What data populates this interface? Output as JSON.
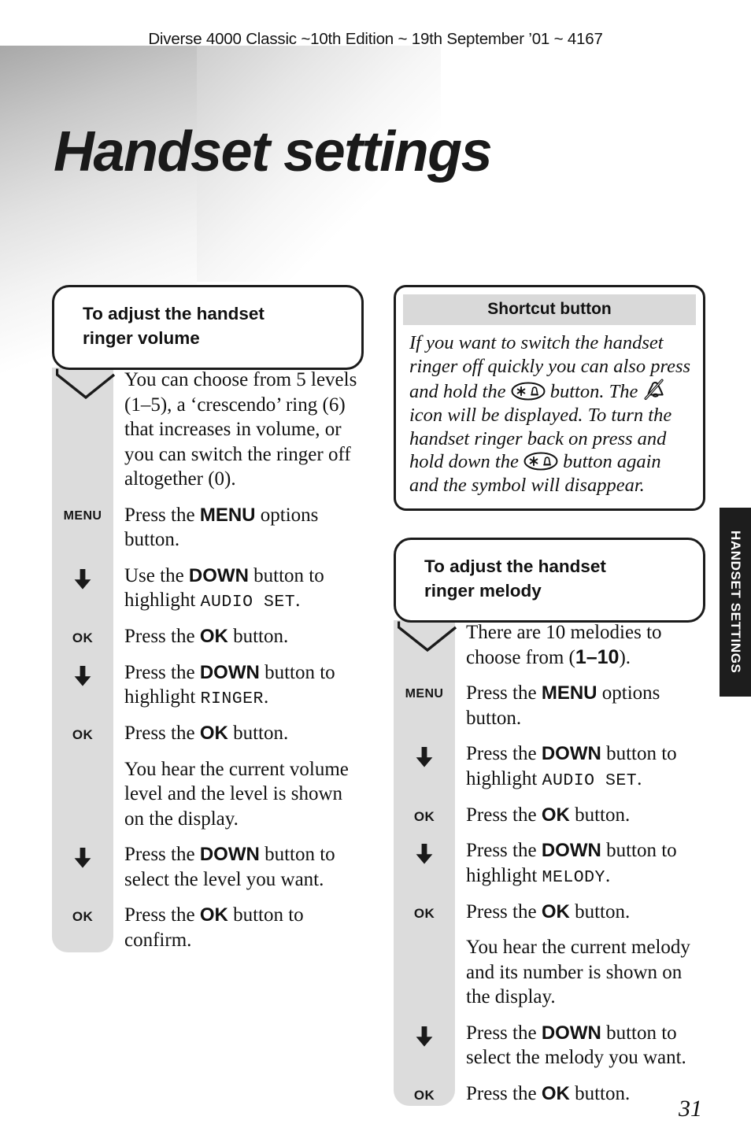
{
  "page": {
    "running_head": "Diverse 4000 Classic ~10th Edition ~ 19th September ’01 ~ 4167",
    "chapter_title": "Handset settings",
    "thumb_tab": "HANDSET SETTINGS",
    "folio": "31",
    "accent_black": "#1d1d1d",
    "rail_grey": "#dcdcdc",
    "band_grey": "#d9d9d9"
  },
  "left_column": {
    "callout": {
      "line1": "To adjust the handset",
      "line2": "ringer volume"
    },
    "steps": [
      {
        "key": "",
        "key_type": "none",
        "text_parts": [
          {
            "t": "You can choose from 5 levels (1–5), a ‘crescendo’ ring (6) that increases in volume, or you can switch the ringer off altogether (0).",
            "style": "normal"
          }
        ]
      },
      {
        "key": "MENU",
        "key_type": "label",
        "text_parts": [
          {
            "t": "Press the ",
            "style": "normal"
          },
          {
            "t": "MENU",
            "style": "bold"
          },
          {
            "t": " options button.",
            "style": "normal"
          }
        ]
      },
      {
        "key": "",
        "key_type": "arrow-down",
        "text_parts": [
          {
            "t": "Use the ",
            "style": "normal"
          },
          {
            "t": "DOWN",
            "style": "bold"
          },
          {
            "t": " button to highlight ",
            "style": "normal"
          },
          {
            "t": "AUDIO SET",
            "style": "lcd"
          },
          {
            "t": ".",
            "style": "normal"
          }
        ]
      },
      {
        "key": "OK",
        "key_type": "label",
        "text_parts": [
          {
            "t": "Press the ",
            "style": "normal"
          },
          {
            "t": "OK",
            "style": "bold"
          },
          {
            "t": " button.",
            "style": "normal"
          }
        ]
      },
      {
        "key": "",
        "key_type": "arrow-down",
        "text_parts": [
          {
            "t": "Press the ",
            "style": "normal"
          },
          {
            "t": "DOWN",
            "style": "bold"
          },
          {
            "t": " button to highlight ",
            "style": "normal"
          },
          {
            "t": "RINGER",
            "style": "lcd"
          },
          {
            "t": ".",
            "style": "normal"
          }
        ]
      },
      {
        "key": "OK",
        "key_type": "label",
        "text_parts": [
          {
            "t": "Press the ",
            "style": "normal"
          },
          {
            "t": "OK",
            "style": "bold"
          },
          {
            "t": " button.",
            "style": "normal"
          }
        ]
      },
      {
        "key": "",
        "key_type": "none",
        "text_parts": [
          {
            "t": "You hear the current volume level and the level is shown on the display.",
            "style": "normal"
          }
        ]
      },
      {
        "key": "",
        "key_type": "arrow-down",
        "text_parts": [
          {
            "t": "Press the ",
            "style": "normal"
          },
          {
            "t": "DOWN",
            "style": "bold"
          },
          {
            "t": " button to select the level you want.",
            "style": "normal"
          }
        ]
      },
      {
        "key": "OK",
        "key_type": "label",
        "text_parts": [
          {
            "t": "Press the ",
            "style": "normal"
          },
          {
            "t": "OK",
            "style": "bold"
          },
          {
            "t": " button to confirm.",
            "style": "normal"
          }
        ]
      }
    ]
  },
  "right_column": {
    "infobox": {
      "heading": "Shortcut button",
      "body_parts": [
        {
          "t": "If you want to switch the handset ringer off quickly you can also press and hold the ",
          "style": "normal"
        },
        {
          "t": "star-bell-button-icon",
          "style": "icon-star-bell"
        },
        {
          "t": " button. The ",
          "style": "normal"
        },
        {
          "t": "ringer-off-bell-icon",
          "style": "icon-bell-off"
        },
        {
          "t": " icon will be displayed. To turn the handset ringer back on press and hold down the ",
          "style": "normal"
        },
        {
          "t": "star-bell-button-icon",
          "style": "icon-star-bell"
        },
        {
          "t": " button again and the symbol will disappear.",
          "style": "normal"
        }
      ]
    },
    "callout": {
      "line1": "To adjust the handset",
      "line2": "ringer melody"
    },
    "steps": [
      {
        "key": "",
        "key_type": "none",
        "text_parts": [
          {
            "t": "There are 10 melodies to choose from (",
            "style": "normal"
          },
          {
            "t": "1–10",
            "style": "bold-serif"
          },
          {
            "t": ").",
            "style": "normal"
          }
        ]
      },
      {
        "key": "MENU",
        "key_type": "label",
        "text_parts": [
          {
            "t": "Press the ",
            "style": "normal"
          },
          {
            "t": "MENU",
            "style": "bold"
          },
          {
            "t": " options button.",
            "style": "normal"
          }
        ]
      },
      {
        "key": "",
        "key_type": "arrow-down",
        "text_parts": [
          {
            "t": "Press the ",
            "style": "normal"
          },
          {
            "t": "DOWN",
            "style": "bold"
          },
          {
            "t": " button to highlight ",
            "style": "normal"
          },
          {
            "t": "AUDIO SET",
            "style": "lcd"
          },
          {
            "t": ".",
            "style": "normal"
          }
        ]
      },
      {
        "key": "OK",
        "key_type": "label",
        "text_parts": [
          {
            "t": "Press the ",
            "style": "normal"
          },
          {
            "t": "OK",
            "style": "bold"
          },
          {
            "t": " button.",
            "style": "normal"
          }
        ]
      },
      {
        "key": "",
        "key_type": "arrow-down",
        "text_parts": [
          {
            "t": "Press the ",
            "style": "normal"
          },
          {
            "t": "DOWN",
            "style": "bold"
          },
          {
            "t": " button to highlight ",
            "style": "normal"
          },
          {
            "t": "MELODY",
            "style": "lcd"
          },
          {
            "t": ".",
            "style": "normal"
          }
        ]
      },
      {
        "key": "OK",
        "key_type": "label",
        "text_parts": [
          {
            "t": "Press the ",
            "style": "normal"
          },
          {
            "t": "OK",
            "style": "bold"
          },
          {
            "t": " button.",
            "style": "normal"
          }
        ]
      },
      {
        "key": "",
        "key_type": "none",
        "text_parts": [
          {
            "t": "You hear the current melody and its number is shown on the display.",
            "style": "normal"
          }
        ]
      },
      {
        "key": "",
        "key_type": "arrow-down",
        "text_parts": [
          {
            "t": "Press the ",
            "style": "normal"
          },
          {
            "t": "DOWN",
            "style": "bold"
          },
          {
            "t": " button to select the melody you want.",
            "style": "normal"
          }
        ]
      },
      {
        "key": "OK",
        "key_type": "label",
        "text_parts": [
          {
            "t": "Press the ",
            "style": "normal"
          },
          {
            "t": "OK",
            "style": "bold"
          },
          {
            "t": " button.",
            "style": "normal"
          }
        ]
      }
    ]
  }
}
